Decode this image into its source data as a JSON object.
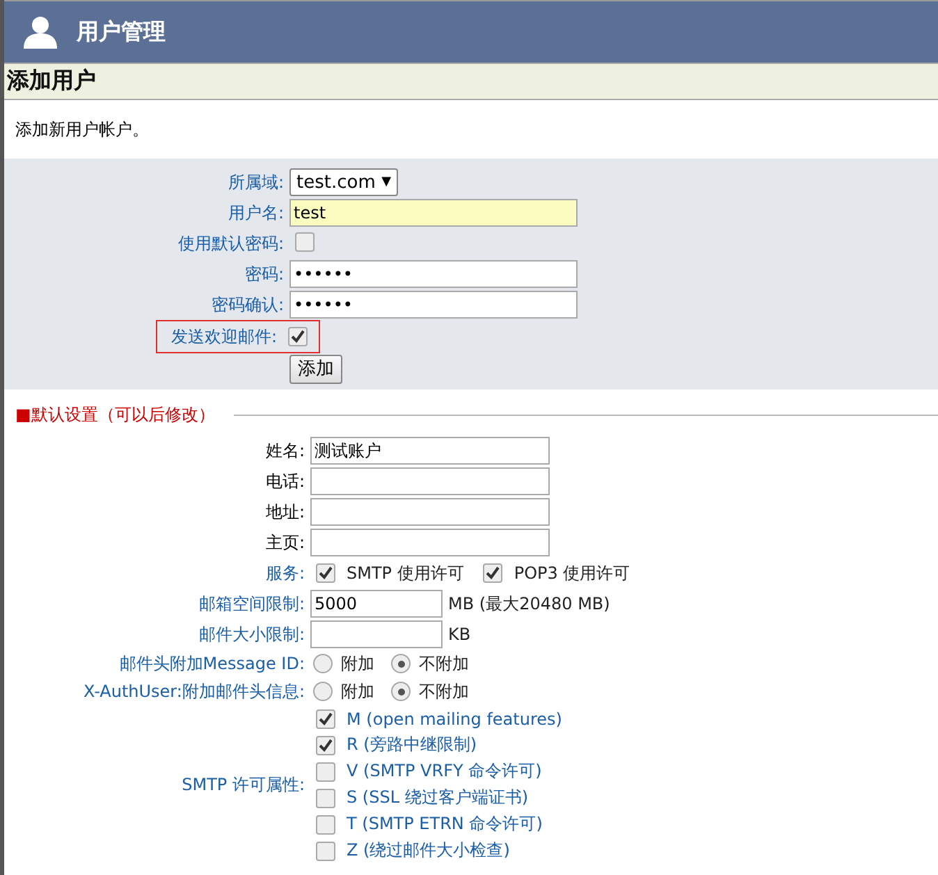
{
  "header": {
    "title": "用户管理"
  },
  "section": {
    "title": "添加用户"
  },
  "description": "添加新用户帐户。",
  "account_form": {
    "fields": [
      {
        "kind": "select",
        "label": "所属域:",
        "value": "test.com",
        "arrow": "▼"
      },
      {
        "kind": "text",
        "label": "用户名:",
        "value": "test",
        "highlighted": true
      },
      {
        "kind": "checkbox",
        "label": "使用默认密码:",
        "checked": false
      },
      {
        "kind": "text",
        "label": "密码:",
        "value": "••••••",
        "highlighted": false
      },
      {
        "kind": "text",
        "label": "密码确认:",
        "value": "••••••",
        "highlighted": false
      },
      {
        "kind": "checkbox",
        "label": "发送欢迎邮件:",
        "checked": true,
        "outlined": true
      }
    ],
    "submit": "添加"
  },
  "defaults": {
    "title": "■默认设置（可以后修改）",
    "fields": [
      {
        "kind": "text",
        "label": "姓名:",
        "value": "测试账户",
        "color": "#000000"
      },
      {
        "kind": "text",
        "label": "电话:",
        "color": "#000000"
      },
      {
        "kind": "text",
        "label": "地址:",
        "color": "#000000"
      },
      {
        "kind": "text",
        "label": "主页:",
        "color": "#000000"
      },
      {
        "kind": "checks",
        "label": "服务:",
        "color": "#1a5ea8",
        "options": [
          {
            "label": "SMTP 使用许可",
            "checked": true
          },
          {
            "label": "POP3 使用许可",
            "checked": true
          }
        ]
      },
      {
        "kind": "unit",
        "label": "邮箱空间限制:",
        "value": "5000",
        "unit": "MB (最大20480 MB)",
        "color": "#1a5ea8"
      },
      {
        "kind": "unit",
        "label": "邮件大小限制:",
        "unit": "KB",
        "color": "#1a5ea8"
      },
      {
        "kind": "radio",
        "label": "邮件头附加Message ID:",
        "color": "#1a5ea8",
        "options": [
          {
            "label": "附加",
            "selected": false
          },
          {
            "label": "不附加",
            "selected": true
          }
        ]
      },
      {
        "kind": "radio",
        "label": "X-AuthUser:附加邮件头信息:",
        "color": "#1a5ea8",
        "options": [
          {
            "label": "附加",
            "selected": false
          },
          {
            "label": "不附加",
            "selected": true
          }
        ]
      },
      {
        "kind": "checklist",
        "label": "SMTP 许可属性:",
        "color": "#1a5ea8",
        "options": [
          {
            "label": "M (open mailing features)",
            "checked": true
          },
          {
            "label": "R (旁路中继限制)",
            "checked": true
          },
          {
            "label": "V (SMTP VRFY 命令许可)",
            "checked": false
          },
          {
            "label": "S (SSL 绕过客户端证书)",
            "checked": false
          },
          {
            "label": "T (SMTP ETRN 命令许可)",
            "checked": false
          },
          {
            "label": "Z (绕过邮件大小检查)",
            "checked": false
          }
        ]
      }
    ]
  }
}
